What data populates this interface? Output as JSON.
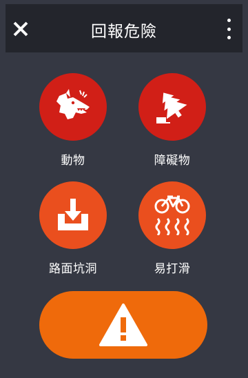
{
  "header": {
    "title": "回報危險",
    "close_icon": "close-icon",
    "menu_icon": "more-vertical-icon"
  },
  "hazards": [
    {
      "label": "動物",
      "icon": "dog-icon",
      "color": "#d11f17"
    },
    {
      "label": "障礙物",
      "icon": "fallen-tree-icon",
      "color": "#d11f17"
    },
    {
      "label": "路面坑洞",
      "icon": "pothole-icon",
      "color": "#ea4f1e"
    },
    {
      "label": "易打滑",
      "icon": "slippery-bicycle-icon",
      "color": "#ea4f1e"
    }
  ],
  "report": {
    "icon": "warning-icon",
    "color": "#ef6a0b"
  }
}
